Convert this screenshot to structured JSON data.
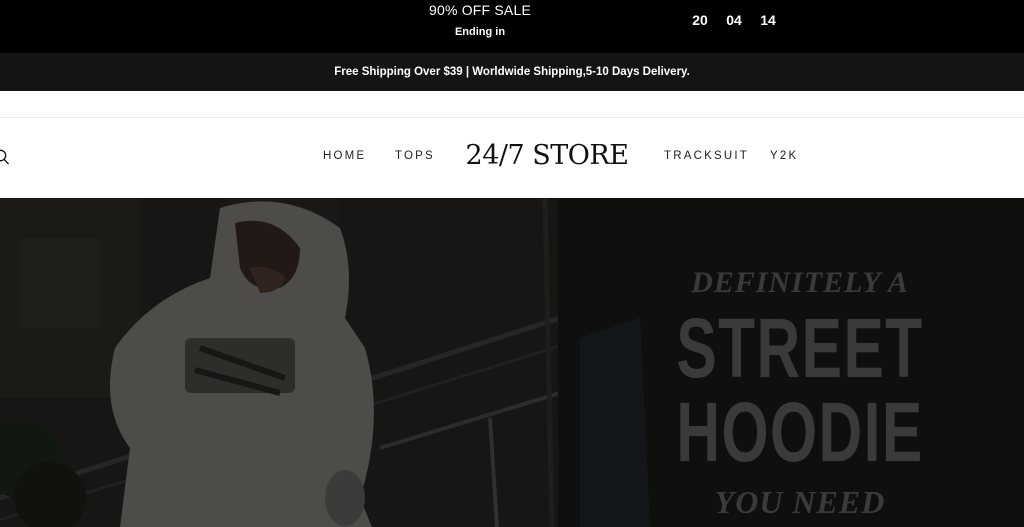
{
  "promo": {
    "sale_text": "90% OFF SALE",
    "ending_text": "Ending in",
    "countdown": [
      "20",
      "04",
      "14"
    ]
  },
  "shipping": {
    "text": "Free Shipping Over $39 | Worldwide Shipping,5-10 Days Delivery."
  },
  "header": {
    "logo": "24/7 STORE",
    "nav": [
      "HOME",
      "TOPS",
      "TRACKSUIT",
      "Y2K"
    ],
    "search_icon": "search-icon"
  },
  "hero": {
    "line1": "DEFINITELY A",
    "line2": "STREET",
    "line3": "HOODIE",
    "line4": "YOU NEED"
  }
}
